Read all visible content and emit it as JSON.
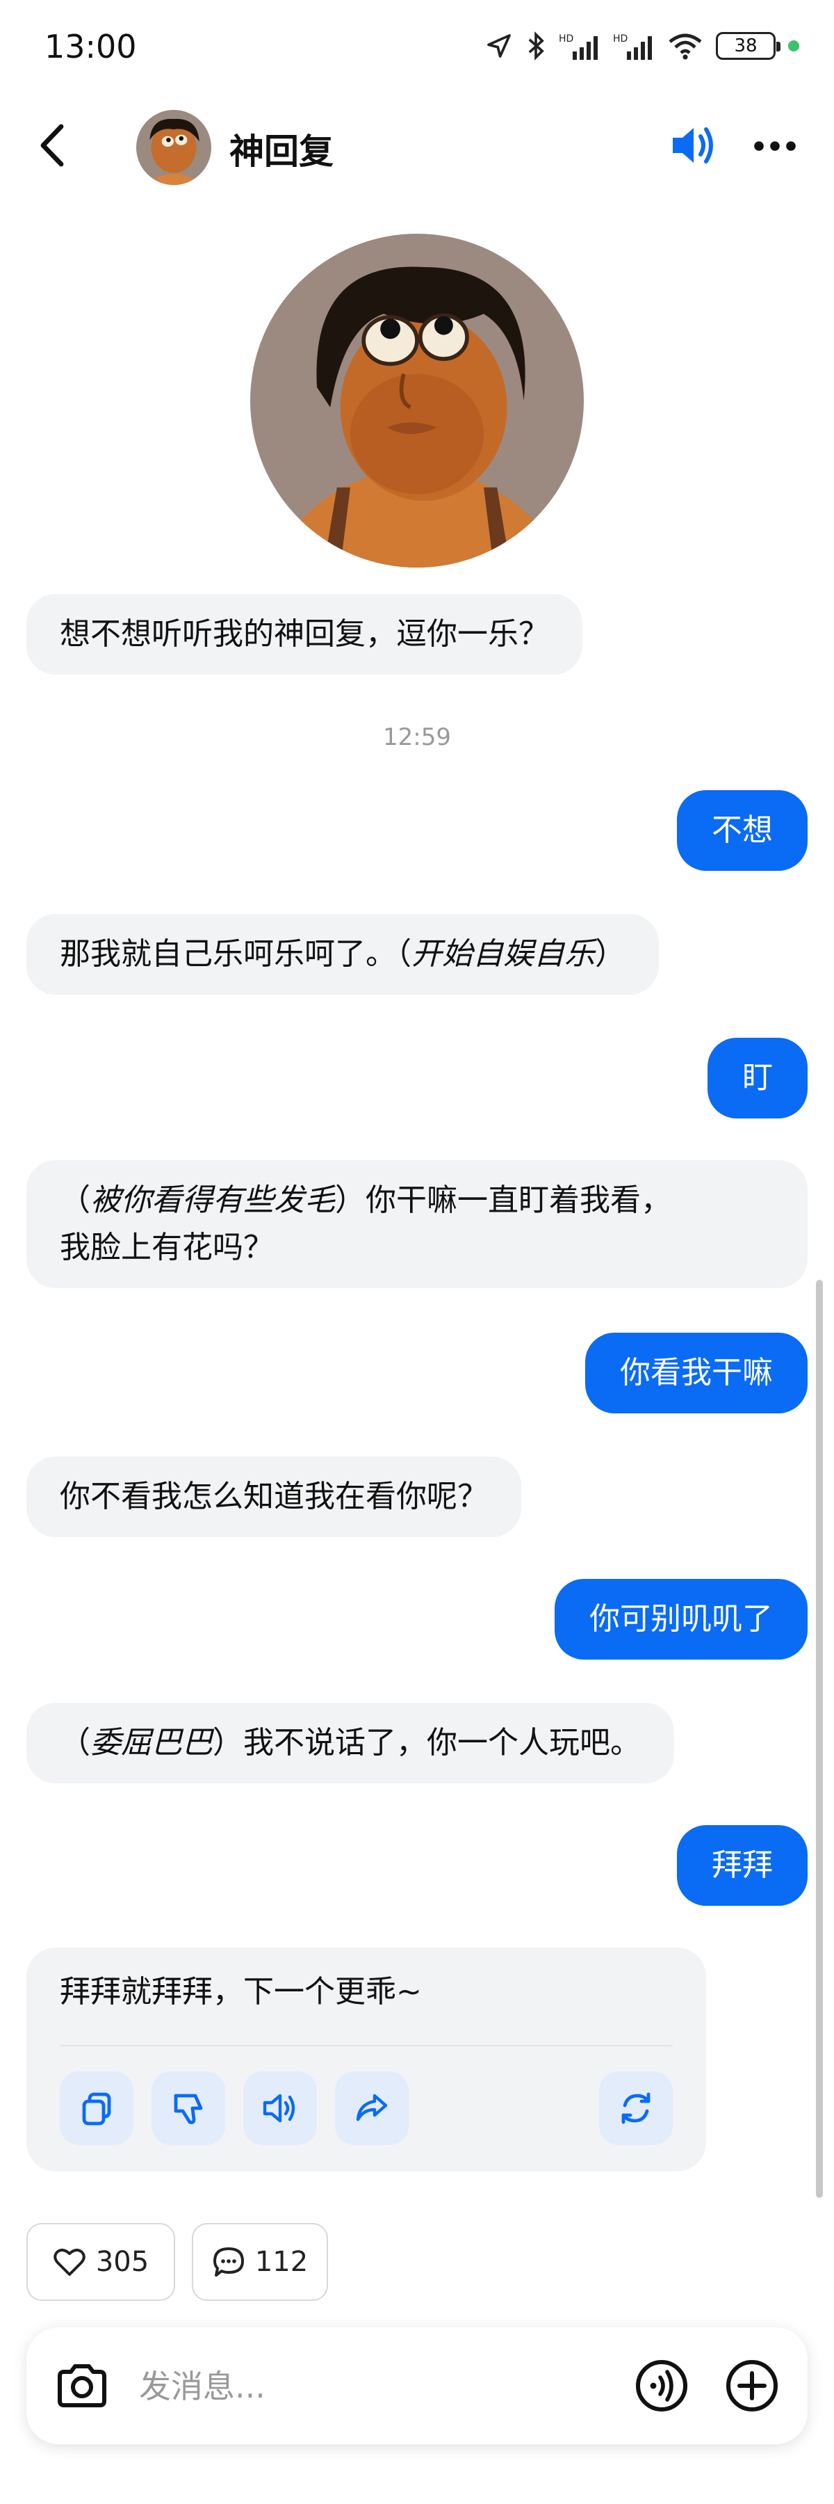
{
  "status": {
    "time": "13:00",
    "battery": "38"
  },
  "header": {
    "title": "神回复"
  },
  "messages": [
    {
      "role": "ai",
      "segments": [
        {
          "text": "想不想听听我的神回复，逗你一乐？",
          "italic": false
        }
      ]
    },
    {
      "role": "time",
      "text": "12:59"
    },
    {
      "role": "me",
      "text": "不想"
    },
    {
      "role": "ai",
      "segments": [
        {
          "text": "那我就自己乐呵乐呵了。（",
          "italic": false
        },
        {
          "text": "开始自娱自乐",
          "italic": true
        },
        {
          "text": "）",
          "italic": false
        }
      ]
    },
    {
      "role": "me",
      "text": "盯"
    },
    {
      "role": "ai",
      "segments": [
        {
          "text": "（",
          "italic": false
        },
        {
          "text": "被你看得有些发毛",
          "italic": true
        },
        {
          "text": "）你干嘛一直盯着我看，",
          "italic": false
        },
        {
          "text": "我脸上有花吗？",
          "italic": false
        }
      ]
    },
    {
      "role": "me",
      "text": "你看我干嘛"
    },
    {
      "role": "ai",
      "segments": [
        {
          "text": "你不看我怎么知道我在看你呢？",
          "italic": false
        }
      ]
    },
    {
      "role": "me",
      "text": "你可别叽叽了"
    },
    {
      "role": "ai",
      "segments": [
        {
          "text": "（",
          "italic": false
        },
        {
          "text": "委屈巴巴",
          "italic": true
        },
        {
          "text": "）我不说话了，你一个人玩吧。",
          "italic": false
        }
      ]
    },
    {
      "role": "me",
      "text": "拜拜"
    },
    {
      "role": "ai",
      "segments": [
        {
          "text": "拜拜就拜拜，下一个更乖~",
          "italic": false
        }
      ]
    }
  ],
  "actions": [
    {
      "name": "copy-icon"
    },
    {
      "name": "dislike-icon"
    },
    {
      "name": "speaker-icon"
    },
    {
      "name": "share-icon"
    },
    {
      "name": "regenerate-icon"
    }
  ],
  "stats": {
    "likes": "305",
    "comments": "112"
  },
  "input": {
    "placeholder": "发消息..."
  },
  "colors": {
    "accent": "#0a6bf5",
    "ai_bubble": "#f2f3f5",
    "action_bg": "#e3ecfb"
  }
}
